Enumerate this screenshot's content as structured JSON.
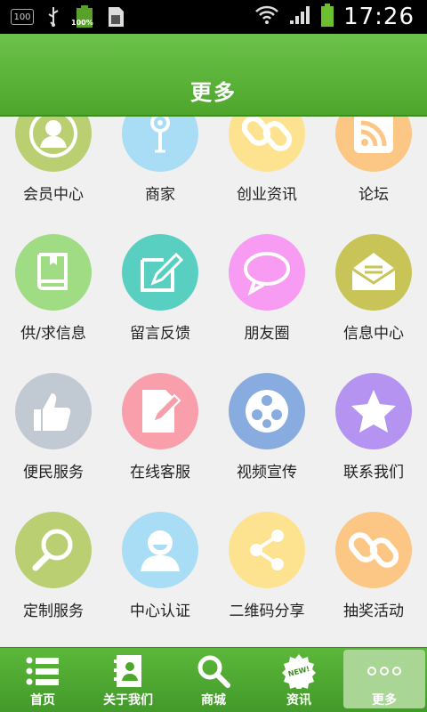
{
  "status_bar": {
    "badge": "100",
    "battery_label": "100%",
    "time": "17:26",
    "icons": [
      "usb-icon",
      "battery-icon",
      "sim-icon",
      "wifi-icon",
      "signal-icon",
      "battery-icon"
    ]
  },
  "header": {
    "title": "更多"
  },
  "grid": {
    "items": [
      {
        "label": "会员中心",
        "icon": "user-icon",
        "color": "#b9cf72"
      },
      {
        "label": "商家",
        "icon": "pin-icon",
        "color": "#a9dcf5"
      },
      {
        "label": "创业资讯",
        "icon": "link-icon",
        "color": "#fde38f"
      },
      {
        "label": "论坛",
        "icon": "rss-icon",
        "color": "#fcc685"
      },
      {
        "label": "供/求信息",
        "icon": "book-icon",
        "color": "#9fdc83"
      },
      {
        "label": "留言反馈",
        "icon": "edit-icon",
        "color": "#59cfc1"
      },
      {
        "label": "朋友圈",
        "icon": "chat-bubble-icon",
        "color": "#f79cf2"
      },
      {
        "label": "信息中心",
        "icon": "mail-icon",
        "color": "#c9c457"
      },
      {
        "label": "便民服务",
        "icon": "thumbs-up-icon",
        "color": "#c1c9d3"
      },
      {
        "label": "在线客服",
        "icon": "document-pen-icon",
        "color": "#f99fab"
      },
      {
        "label": "视频宣传",
        "icon": "film-reel-icon",
        "color": "#88abe0"
      },
      {
        "label": "联系我们",
        "icon": "star-icon",
        "color": "#b494f0"
      },
      {
        "label": "定制服务",
        "icon": "magnifier-icon",
        "color": "#b9cf72"
      },
      {
        "label": "中心认证",
        "icon": "person-icon",
        "color": "#a9dcf5"
      },
      {
        "label": "二维码分享",
        "icon": "share-icon",
        "color": "#fde38f"
      },
      {
        "label": "抽奖活动",
        "icon": "link-icon",
        "color": "#fcc685"
      }
    ]
  },
  "bottom_nav": {
    "items": [
      {
        "label": "首页",
        "icon": "list-icon"
      },
      {
        "label": "关于我们",
        "icon": "contact-card-icon"
      },
      {
        "label": "商城",
        "icon": "search-icon"
      },
      {
        "label": "资讯",
        "icon": "new-badge-icon",
        "badge": "NEW!"
      },
      {
        "label": "更多",
        "icon": "more-dots-icon",
        "active": true
      }
    ]
  }
}
